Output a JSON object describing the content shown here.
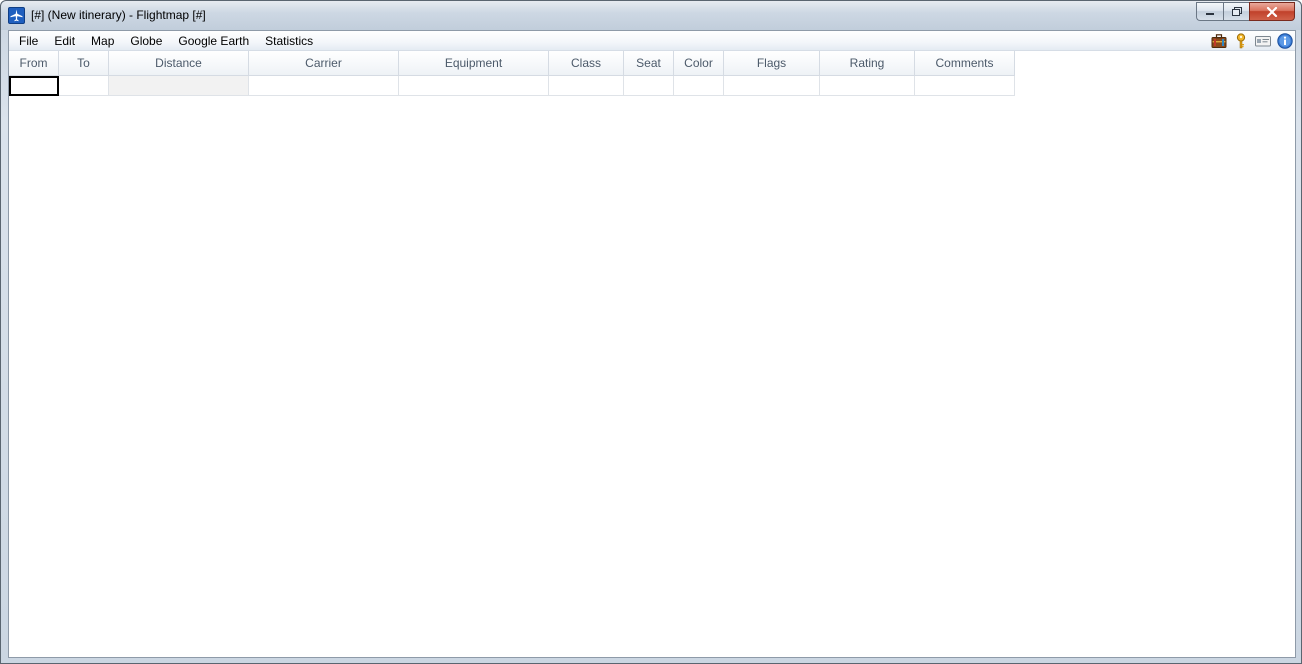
{
  "window": {
    "title": "[#] (New itinerary) - Flightmap [#]"
  },
  "menu": [
    "File",
    "Edit",
    "Map",
    "Globe",
    "Google Earth",
    "Statistics"
  ],
  "toolbar_icons": [
    "suitcase-icon",
    "key-icon",
    "card-icon",
    "info-icon"
  ],
  "table": {
    "columns": [
      "From",
      "To",
      "Distance",
      "Carrier",
      "Equipment",
      "Class",
      "Seat",
      "Color",
      "Flags",
      "Rating",
      "Comments"
    ],
    "rows": [
      [
        "",
        "",
        "",
        "",
        "",
        "",
        "",
        "",
        "",
        "",
        ""
      ]
    ]
  },
  "colors": {
    "accent": "#1f5fbf",
    "close_button": "#c0412a"
  }
}
